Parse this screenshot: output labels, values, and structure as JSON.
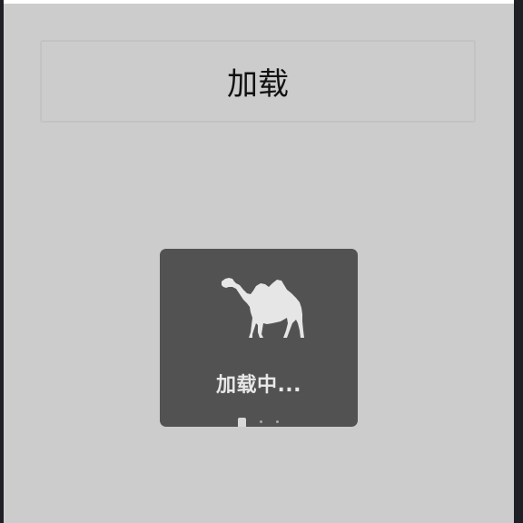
{
  "button": {
    "label": "加载"
  },
  "loading": {
    "text": "加载中...",
    "icon": "camel-icon",
    "dots": 3,
    "active_dot": 1
  },
  "colors": {
    "background": "#cccccc",
    "toast_background": "#525252",
    "toast_text": "#e8e8e8",
    "icon": "#e6e6e6"
  }
}
